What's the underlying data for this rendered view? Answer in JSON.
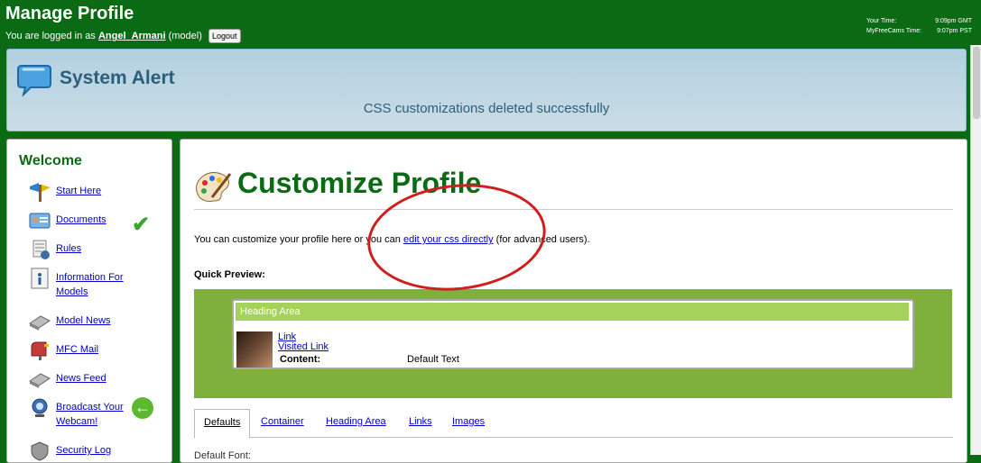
{
  "header": {
    "title": "Manage Profile",
    "login_prefix": "You are logged in as",
    "username": "Angel_Armani",
    "role": "(model)",
    "logout_label": "Logout",
    "times": [
      {
        "label": "Your Time:",
        "value": "9:09pm GMT"
      },
      {
        "label": "MyFreeCams Time:",
        "value": "9:07pm PST"
      }
    ]
  },
  "alert": {
    "title": "System Alert",
    "message": "CSS customizations deleted successfully"
  },
  "sidebar": {
    "title": "Welcome",
    "items": [
      {
        "label": "Start Here",
        "icon": "signpost-icon"
      },
      {
        "label": "Documents",
        "icon": "id-card-icon"
      },
      {
        "label": "Rules",
        "icon": "rules-icon"
      },
      {
        "label": "Information For Models",
        "icon": "info-icon"
      },
      {
        "label": "Model News",
        "icon": "news-icon"
      },
      {
        "label": "MFC Mail",
        "icon": "mailbox-icon"
      },
      {
        "label": "News Feed",
        "icon": "feed-icon"
      },
      {
        "label": "Broadcast Your Webcam!",
        "icon": "webcam-icon"
      },
      {
        "label": "Security Log",
        "icon": "security-icon"
      }
    ]
  },
  "main": {
    "title": "Customize Profile",
    "intro_before": "You can customize your profile here or you can ",
    "intro_link": "edit your css directly",
    "intro_after": " (for advanced users).",
    "quick_preview_label": "Quick Preview:",
    "preview": {
      "heading": "Heading Area",
      "link": "Link",
      "visited_link": "Visited Link",
      "content_label": "Content:",
      "content_value": "Default Text"
    },
    "tabs": [
      "Defaults",
      "Container",
      "Heading Area",
      "Links",
      "Images"
    ],
    "default_font_label": "Default Font:"
  },
  "colors": {
    "background": "#0b6b14",
    "alert_text": "#2c5f7c",
    "accent_green": "#7fb03b",
    "annotation": "#d01e1e"
  }
}
